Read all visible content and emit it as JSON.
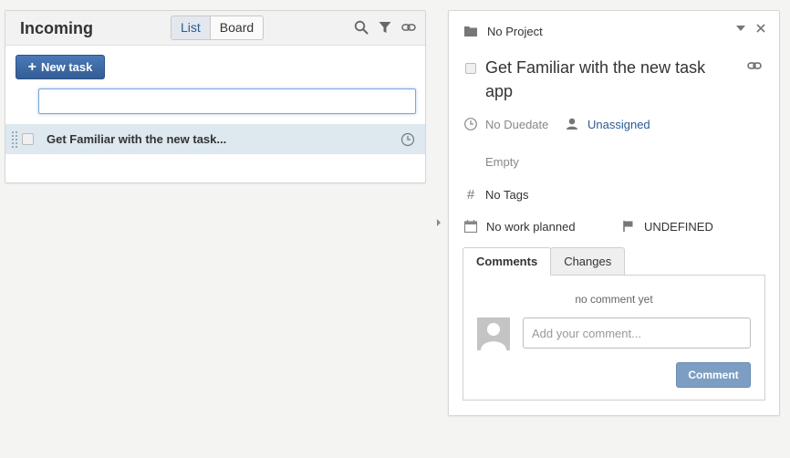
{
  "list_panel": {
    "title": "Incoming",
    "views": [
      "List",
      "Board"
    ],
    "active_view": "List",
    "new_task_label": "New task",
    "task_input_value": "",
    "tasks": [
      {
        "title": "Get Familiar with the new task..."
      }
    ]
  },
  "detail": {
    "project": "No Project",
    "title": "Get Familiar with the new task app",
    "duedate": "No Duedate",
    "assignee": "Unassigned",
    "description": "Empty",
    "tags": "No Tags",
    "work": "No work planned",
    "priority": "UNDEFINED",
    "tags_icon_glyph": "#",
    "tabs": [
      "Comments",
      "Changes"
    ],
    "active_tab": "Comments",
    "no_comment": "no comment yet",
    "comment_placeholder": "Add your comment...",
    "comment_button": "Comment"
  },
  "colors": {
    "accent_blue": "#3c6aa5",
    "link_blue": "#2a5b95",
    "row_highlight": "#dde8ef",
    "disabled_button": "#7d9ec3"
  },
  "icons": [
    "plus-icon",
    "search-icon",
    "filter-icon",
    "link-icon",
    "drag-handle-icon",
    "clock-icon",
    "folder-icon",
    "chevron-down-icon",
    "close-icon",
    "user-icon",
    "hash-icon",
    "calendar-icon",
    "flag-icon",
    "collapse-arrow-icon",
    "avatar-icon"
  ]
}
